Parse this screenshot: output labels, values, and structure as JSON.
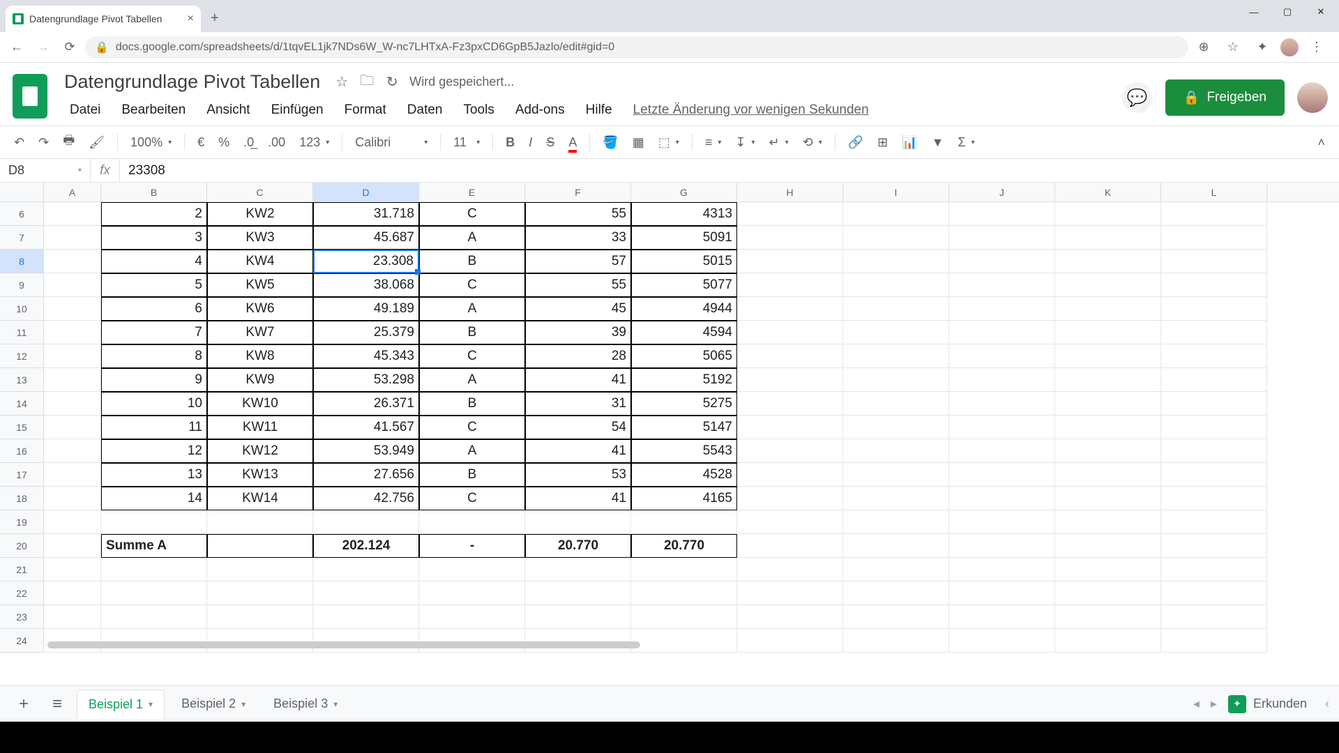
{
  "browser": {
    "tab_title": "Datengrundlage Pivot Tabellen",
    "url": "docs.google.com/spreadsheets/d/1tqvEL1jk7NDs6W_W-nc7LHTxA-Fz3pxCD6GpB5Jazlo/edit#gid=0"
  },
  "doc": {
    "title": "Datengrundlage Pivot Tabellen",
    "save_status": "Wird gespeichert...",
    "last_change": "Letzte Änderung vor wenigen Sekunden",
    "share_label": "Freigeben"
  },
  "menu": {
    "datei": "Datei",
    "bearbeiten": "Bearbeiten",
    "ansicht": "Ansicht",
    "einfuegen": "Einfügen",
    "format": "Format",
    "daten": "Daten",
    "tools": "Tools",
    "addons": "Add-ons",
    "hilfe": "Hilfe"
  },
  "toolbar": {
    "zoom": "100%",
    "euro": "€",
    "percent": "%",
    "dec_dec": ".0̲",
    "dec_inc": ".00",
    "num_format": "123",
    "font": "Calibri",
    "size": "11"
  },
  "name_box": "D8",
  "formula": "23308",
  "columns": [
    "A",
    "B",
    "C",
    "D",
    "E",
    "F",
    "G",
    "H",
    "I",
    "J",
    "K",
    "L"
  ],
  "col_widths": [
    "wA",
    "wB",
    "wC",
    "wD",
    "wE",
    "wF",
    "wG",
    "wH",
    "wI",
    "wJ",
    "wK",
    "wL"
  ],
  "selected_col_idx": 3,
  "rows": [
    {
      "n": 6,
      "sel": false,
      "cells": [
        {
          "v": "",
          "k": ""
        },
        {
          "v": "2",
          "k": "b-all r"
        },
        {
          "v": "KW2",
          "k": "b-all c"
        },
        {
          "v": "31.718",
          "k": "b-all r"
        },
        {
          "v": "C",
          "k": "b-all c"
        },
        {
          "v": "55",
          "k": "b-all r"
        },
        {
          "v": "4313",
          "k": "b-all r"
        },
        {
          "v": "",
          "k": ""
        },
        {
          "v": "",
          "k": ""
        },
        {
          "v": "",
          "k": ""
        },
        {
          "v": "",
          "k": ""
        },
        {
          "v": "",
          "k": ""
        }
      ]
    },
    {
      "n": 7,
      "sel": false,
      "cells": [
        {
          "v": "",
          "k": ""
        },
        {
          "v": "3",
          "k": "b-all r"
        },
        {
          "v": "KW3",
          "k": "b-all c"
        },
        {
          "v": "45.687",
          "k": "b-all r"
        },
        {
          "v": "A",
          "k": "b-all c"
        },
        {
          "v": "33",
          "k": "b-all r"
        },
        {
          "v": "5091",
          "k": "b-all r"
        },
        {
          "v": "",
          "k": ""
        },
        {
          "v": "",
          "k": ""
        },
        {
          "v": "",
          "k": ""
        },
        {
          "v": "",
          "k": ""
        },
        {
          "v": "",
          "k": ""
        }
      ]
    },
    {
      "n": 8,
      "sel": true,
      "cells": [
        {
          "v": "",
          "k": ""
        },
        {
          "v": "4",
          "k": "b-all r"
        },
        {
          "v": "KW4",
          "k": "b-all c"
        },
        {
          "v": "23.308",
          "k": "b-all r selected"
        },
        {
          "v": "B",
          "k": "b-all c"
        },
        {
          "v": "57",
          "k": "b-all r"
        },
        {
          "v": "5015",
          "k": "b-all r"
        },
        {
          "v": "",
          "k": ""
        },
        {
          "v": "",
          "k": ""
        },
        {
          "v": "",
          "k": ""
        },
        {
          "v": "",
          "k": ""
        },
        {
          "v": "",
          "k": ""
        }
      ]
    },
    {
      "n": 9,
      "sel": false,
      "cells": [
        {
          "v": "",
          "k": ""
        },
        {
          "v": "5",
          "k": "b-all r"
        },
        {
          "v": "KW5",
          "k": "b-all c"
        },
        {
          "v": "38.068",
          "k": "b-all r"
        },
        {
          "v": "C",
          "k": "b-all c"
        },
        {
          "v": "55",
          "k": "b-all r"
        },
        {
          "v": "5077",
          "k": "b-all r"
        },
        {
          "v": "",
          "k": ""
        },
        {
          "v": "",
          "k": ""
        },
        {
          "v": "",
          "k": ""
        },
        {
          "v": "",
          "k": ""
        },
        {
          "v": "",
          "k": ""
        }
      ]
    },
    {
      "n": 10,
      "sel": false,
      "cells": [
        {
          "v": "",
          "k": ""
        },
        {
          "v": "6",
          "k": "b-all r"
        },
        {
          "v": "KW6",
          "k": "b-all c"
        },
        {
          "v": "49.189",
          "k": "b-all r"
        },
        {
          "v": "A",
          "k": "b-all c"
        },
        {
          "v": "45",
          "k": "b-all r"
        },
        {
          "v": "4944",
          "k": "b-all r"
        },
        {
          "v": "",
          "k": ""
        },
        {
          "v": "",
          "k": ""
        },
        {
          "v": "",
          "k": ""
        },
        {
          "v": "",
          "k": ""
        },
        {
          "v": "",
          "k": ""
        }
      ]
    },
    {
      "n": 11,
      "sel": false,
      "cells": [
        {
          "v": "",
          "k": ""
        },
        {
          "v": "7",
          "k": "b-all r"
        },
        {
          "v": "KW7",
          "k": "b-all c"
        },
        {
          "v": "25.379",
          "k": "b-all r"
        },
        {
          "v": "B",
          "k": "b-all c"
        },
        {
          "v": "39",
          "k": "b-all r"
        },
        {
          "v": "4594",
          "k": "b-all r"
        },
        {
          "v": "",
          "k": ""
        },
        {
          "v": "",
          "k": ""
        },
        {
          "v": "",
          "k": ""
        },
        {
          "v": "",
          "k": ""
        },
        {
          "v": "",
          "k": ""
        }
      ]
    },
    {
      "n": 12,
      "sel": false,
      "cells": [
        {
          "v": "",
          "k": ""
        },
        {
          "v": "8",
          "k": "b-all r"
        },
        {
          "v": "KW8",
          "k": "b-all c"
        },
        {
          "v": "45.343",
          "k": "b-all r"
        },
        {
          "v": "C",
          "k": "b-all c"
        },
        {
          "v": "28",
          "k": "b-all r"
        },
        {
          "v": "5065",
          "k": "b-all r"
        },
        {
          "v": "",
          "k": ""
        },
        {
          "v": "",
          "k": ""
        },
        {
          "v": "",
          "k": ""
        },
        {
          "v": "",
          "k": ""
        },
        {
          "v": "",
          "k": ""
        }
      ]
    },
    {
      "n": 13,
      "sel": false,
      "cells": [
        {
          "v": "",
          "k": ""
        },
        {
          "v": "9",
          "k": "b-all r"
        },
        {
          "v": "KW9",
          "k": "b-all c"
        },
        {
          "v": "53.298",
          "k": "b-all r"
        },
        {
          "v": "A",
          "k": "b-all c"
        },
        {
          "v": "41",
          "k": "b-all r"
        },
        {
          "v": "5192",
          "k": "b-all r"
        },
        {
          "v": "",
          "k": ""
        },
        {
          "v": "",
          "k": ""
        },
        {
          "v": "",
          "k": ""
        },
        {
          "v": "",
          "k": ""
        },
        {
          "v": "",
          "k": ""
        }
      ]
    },
    {
      "n": 14,
      "sel": false,
      "cells": [
        {
          "v": "",
          "k": ""
        },
        {
          "v": "10",
          "k": "b-all r"
        },
        {
          "v": "KW10",
          "k": "b-all c"
        },
        {
          "v": "26.371",
          "k": "b-all r"
        },
        {
          "v": "B",
          "k": "b-all c"
        },
        {
          "v": "31",
          "k": "b-all r"
        },
        {
          "v": "5275",
          "k": "b-all r"
        },
        {
          "v": "",
          "k": ""
        },
        {
          "v": "",
          "k": ""
        },
        {
          "v": "",
          "k": ""
        },
        {
          "v": "",
          "k": ""
        },
        {
          "v": "",
          "k": ""
        }
      ]
    },
    {
      "n": 15,
      "sel": false,
      "cells": [
        {
          "v": "",
          "k": ""
        },
        {
          "v": "11",
          "k": "b-all r"
        },
        {
          "v": "KW11",
          "k": "b-all c"
        },
        {
          "v": "41.567",
          "k": "b-all r"
        },
        {
          "v": "C",
          "k": "b-all c"
        },
        {
          "v": "54",
          "k": "b-all r"
        },
        {
          "v": "5147",
          "k": "b-all r"
        },
        {
          "v": "",
          "k": ""
        },
        {
          "v": "",
          "k": ""
        },
        {
          "v": "",
          "k": ""
        },
        {
          "v": "",
          "k": ""
        },
        {
          "v": "",
          "k": ""
        }
      ]
    },
    {
      "n": 16,
      "sel": false,
      "cells": [
        {
          "v": "",
          "k": ""
        },
        {
          "v": "12",
          "k": "b-all r"
        },
        {
          "v": "KW12",
          "k": "b-all c"
        },
        {
          "v": "53.949",
          "k": "b-all r"
        },
        {
          "v": "A",
          "k": "b-all c"
        },
        {
          "v": "41",
          "k": "b-all r"
        },
        {
          "v": "5543",
          "k": "b-all r"
        },
        {
          "v": "",
          "k": ""
        },
        {
          "v": "",
          "k": ""
        },
        {
          "v": "",
          "k": ""
        },
        {
          "v": "",
          "k": ""
        },
        {
          "v": "",
          "k": ""
        }
      ]
    },
    {
      "n": 17,
      "sel": false,
      "cells": [
        {
          "v": "",
          "k": ""
        },
        {
          "v": "13",
          "k": "b-all r"
        },
        {
          "v": "KW13",
          "k": "b-all c"
        },
        {
          "v": "27.656",
          "k": "b-all r"
        },
        {
          "v": "B",
          "k": "b-all c"
        },
        {
          "v": "53",
          "k": "b-all r"
        },
        {
          "v": "4528",
          "k": "b-all r"
        },
        {
          "v": "",
          "k": ""
        },
        {
          "v": "",
          "k": ""
        },
        {
          "v": "",
          "k": ""
        },
        {
          "v": "",
          "k": ""
        },
        {
          "v": "",
          "k": ""
        }
      ]
    },
    {
      "n": 18,
      "sel": false,
      "cells": [
        {
          "v": "",
          "k": ""
        },
        {
          "v": "14",
          "k": "b-all r"
        },
        {
          "v": "KW14",
          "k": "b-all c"
        },
        {
          "v": "42.756",
          "k": "b-all r"
        },
        {
          "v": "C",
          "k": "b-all c"
        },
        {
          "v": "41",
          "k": "b-all r"
        },
        {
          "v": "4165",
          "k": "b-all r"
        },
        {
          "v": "",
          "k": ""
        },
        {
          "v": "",
          "k": ""
        },
        {
          "v": "",
          "k": ""
        },
        {
          "v": "",
          "k": ""
        },
        {
          "v": "",
          "k": ""
        }
      ]
    },
    {
      "n": 19,
      "sel": false,
      "cells": [
        {
          "v": "",
          "k": ""
        },
        {
          "v": "",
          "k": ""
        },
        {
          "v": "",
          "k": ""
        },
        {
          "v": "",
          "k": ""
        },
        {
          "v": "",
          "k": ""
        },
        {
          "v": "",
          "k": ""
        },
        {
          "v": "",
          "k": ""
        },
        {
          "v": "",
          "k": ""
        },
        {
          "v": "",
          "k": ""
        },
        {
          "v": "",
          "k": ""
        },
        {
          "v": "",
          "k": ""
        },
        {
          "v": "",
          "k": ""
        }
      ]
    },
    {
      "n": 20,
      "sel": false,
      "cells": [
        {
          "v": "",
          "k": ""
        },
        {
          "v": "Summe A",
          "k": "b-all bold"
        },
        {
          "v": "",
          "k": "b-all"
        },
        {
          "v": "202.124",
          "k": "b-all c bold"
        },
        {
          "v": "-",
          "k": "b-all c bold"
        },
        {
          "v": "20.770",
          "k": "b-all c bold"
        },
        {
          "v": "20.770",
          "k": "b-all c bold"
        },
        {
          "v": "",
          "k": ""
        },
        {
          "v": "",
          "k": ""
        },
        {
          "v": "",
          "k": ""
        },
        {
          "v": "",
          "k": ""
        },
        {
          "v": "",
          "k": ""
        }
      ]
    },
    {
      "n": 21,
      "sel": false,
      "cells": [
        {
          "v": "",
          "k": ""
        },
        {
          "v": "",
          "k": ""
        },
        {
          "v": "",
          "k": ""
        },
        {
          "v": "",
          "k": ""
        },
        {
          "v": "",
          "k": ""
        },
        {
          "v": "",
          "k": ""
        },
        {
          "v": "",
          "k": ""
        },
        {
          "v": "",
          "k": ""
        },
        {
          "v": "",
          "k": ""
        },
        {
          "v": "",
          "k": ""
        },
        {
          "v": "",
          "k": ""
        },
        {
          "v": "",
          "k": ""
        }
      ]
    },
    {
      "n": 22,
      "sel": false,
      "cells": [
        {
          "v": "",
          "k": ""
        },
        {
          "v": "",
          "k": ""
        },
        {
          "v": "",
          "k": ""
        },
        {
          "v": "",
          "k": ""
        },
        {
          "v": "",
          "k": ""
        },
        {
          "v": "",
          "k": ""
        },
        {
          "v": "",
          "k": ""
        },
        {
          "v": "",
          "k": ""
        },
        {
          "v": "",
          "k": ""
        },
        {
          "v": "",
          "k": ""
        },
        {
          "v": "",
          "k": ""
        },
        {
          "v": "",
          "k": ""
        }
      ]
    },
    {
      "n": 23,
      "sel": false,
      "cells": [
        {
          "v": "",
          "k": ""
        },
        {
          "v": "",
          "k": ""
        },
        {
          "v": "",
          "k": ""
        },
        {
          "v": "",
          "k": ""
        },
        {
          "v": "",
          "k": ""
        },
        {
          "v": "",
          "k": ""
        },
        {
          "v": "",
          "k": ""
        },
        {
          "v": "",
          "k": ""
        },
        {
          "v": "",
          "k": ""
        },
        {
          "v": "",
          "k": ""
        },
        {
          "v": "",
          "k": ""
        },
        {
          "v": "",
          "k": ""
        }
      ]
    },
    {
      "n": 24,
      "sel": false,
      "cells": [
        {
          "v": "",
          "k": ""
        },
        {
          "v": "",
          "k": ""
        },
        {
          "v": "",
          "k": ""
        },
        {
          "v": "",
          "k": ""
        },
        {
          "v": "",
          "k": ""
        },
        {
          "v": "",
          "k": ""
        },
        {
          "v": "",
          "k": ""
        },
        {
          "v": "",
          "k": ""
        },
        {
          "v": "",
          "k": ""
        },
        {
          "v": "",
          "k": ""
        },
        {
          "v": "",
          "k": ""
        },
        {
          "v": "",
          "k": ""
        }
      ]
    }
  ],
  "sheet_tabs": [
    {
      "label": "Beispiel 1",
      "active": true
    },
    {
      "label": "Beispiel 2",
      "active": false
    },
    {
      "label": "Beispiel 3",
      "active": false
    }
  ],
  "explore": "Erkunden"
}
